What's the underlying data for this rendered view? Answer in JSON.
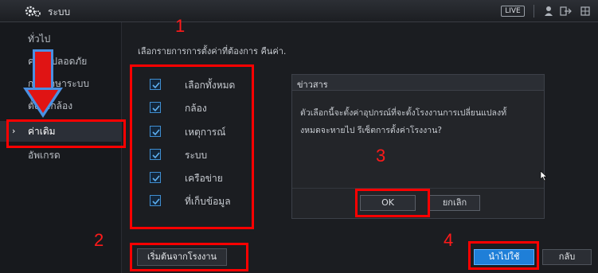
{
  "titlebar": {
    "title": "ระบบ",
    "live_badge": "LIVE",
    "icons": [
      "gear-icon",
      "user-icon",
      "logout-icon",
      "grid-icon"
    ]
  },
  "sidebar": {
    "items": [
      {
        "label": "ทั่วไป",
        "active": false
      },
      {
        "label": "ความปลอดภัย",
        "active": false
      },
      {
        "label": "การรักษาระบบ",
        "active": false
      },
      {
        "label": "ตั้งค่ากล้อง",
        "active": false
      },
      {
        "label": "ค่าเดิม",
        "active": true
      },
      {
        "label": "อัพเกรด",
        "active": false
      }
    ]
  },
  "main": {
    "instruction": "เลือกรายการการตั้งค่าที่ต้องการ คืนค่า.",
    "options": [
      {
        "label": "เลือกทั้งหมด",
        "checked": true
      },
      {
        "label": "กล้อง",
        "checked": true
      },
      {
        "label": "เหตุการณ์",
        "checked": true
      },
      {
        "label": "ระบบ",
        "checked": true
      },
      {
        "label": "เครือข่าย",
        "checked": true
      },
      {
        "label": "ที่เก็บข้อมูล",
        "checked": true
      }
    ],
    "factory_button": "เริ่มต้นจากโรงงาน",
    "apply_button": "นำไปใช้",
    "back_button": "กลับ"
  },
  "dialog": {
    "title": "ข่าวสาร",
    "message_line1": "ตัวเลือกนี้จะตั้งค่าอุปกรณ์ที่จะตั้งโรงงานการเปลี่ยนแปลงทั้",
    "message_line2": "งหมดจะหายไป รีเซ็ตการตั้งค่าโรงงาน?",
    "ok_button": "OK",
    "cancel_button": "ยกเลิก"
  },
  "annotations": {
    "step1": "1",
    "step2": "2",
    "step3": "3",
    "step4": "4",
    "color": "#ff0000"
  },
  "colors": {
    "accent": "#1f7fd8",
    "checkbox": "#3f8ed1",
    "arrow": "#4a90e2"
  }
}
